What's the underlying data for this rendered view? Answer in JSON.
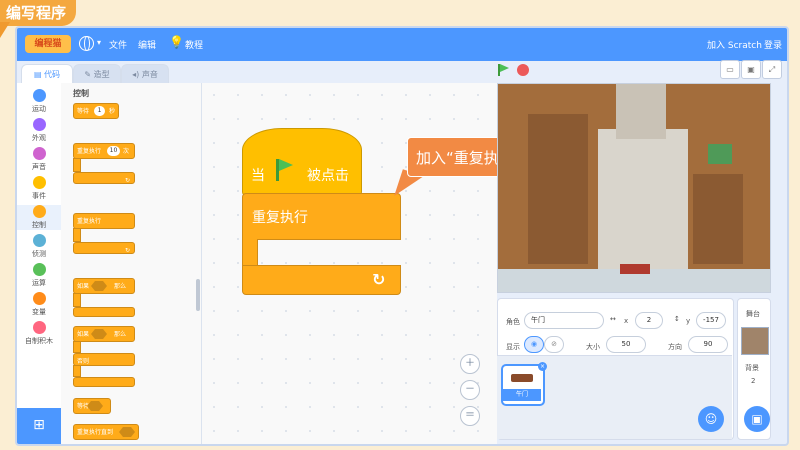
{
  "slide": {
    "title": "编写程序"
  },
  "menubar": {
    "logo": "编程猫",
    "items": [
      "文件",
      "编辑"
    ],
    "tutorial": "教程",
    "join": "加入 Scratch",
    "login": "登录",
    "bg": "#4c97ff"
  },
  "tabs": [
    "代码",
    "造型",
    "声音"
  ],
  "categories": [
    {
      "label": "运动",
      "color": "#4c97ff"
    },
    {
      "label": "外观",
      "color": "#9966ff"
    },
    {
      "label": "声音",
      "color": "#cf63cf"
    },
    {
      "label": "事件",
      "color": "#ffbf00"
    },
    {
      "label": "控制",
      "color": "#ffab19"
    },
    {
      "label": "侦测",
      "color": "#5cb1d6"
    },
    {
      "label": "运算",
      "color": "#59c059"
    },
    {
      "label": "变量",
      "color": "#ff8c1a"
    },
    {
      "label": "自制积木",
      "color": "#ff6680"
    }
  ],
  "palette": {
    "heading": "控制",
    "wait": "等待",
    "wait_value": "1",
    "wait_unit": "秒",
    "repeat": "重复执行",
    "repeat_value": "10",
    "repeat_unit": "次",
    "forever": "重复执行",
    "if": "如果",
    "then": "那么",
    "else": "否则",
    "wait_until": "等待",
    "repeat_until": "重复执行直到"
  },
  "script": {
    "hat_when": "当",
    "hat_clicked": "被点击",
    "forever": "重复执行"
  },
  "callout": "加入“重复执行”指令模块",
  "sprite": {
    "sprite_label": "角色",
    "sprite_name": "午门",
    "x_label": "x",
    "x": "2",
    "y_label": "y",
    "y": "-157",
    "show_label": "显示",
    "size_label": "大小",
    "size": "50",
    "direction_label": "方向",
    "direction": "90",
    "thumb_name": "午门"
  },
  "stage_panel": {
    "title": "舞台",
    "backdrop_label": "背景",
    "backdrop_count": "2"
  }
}
